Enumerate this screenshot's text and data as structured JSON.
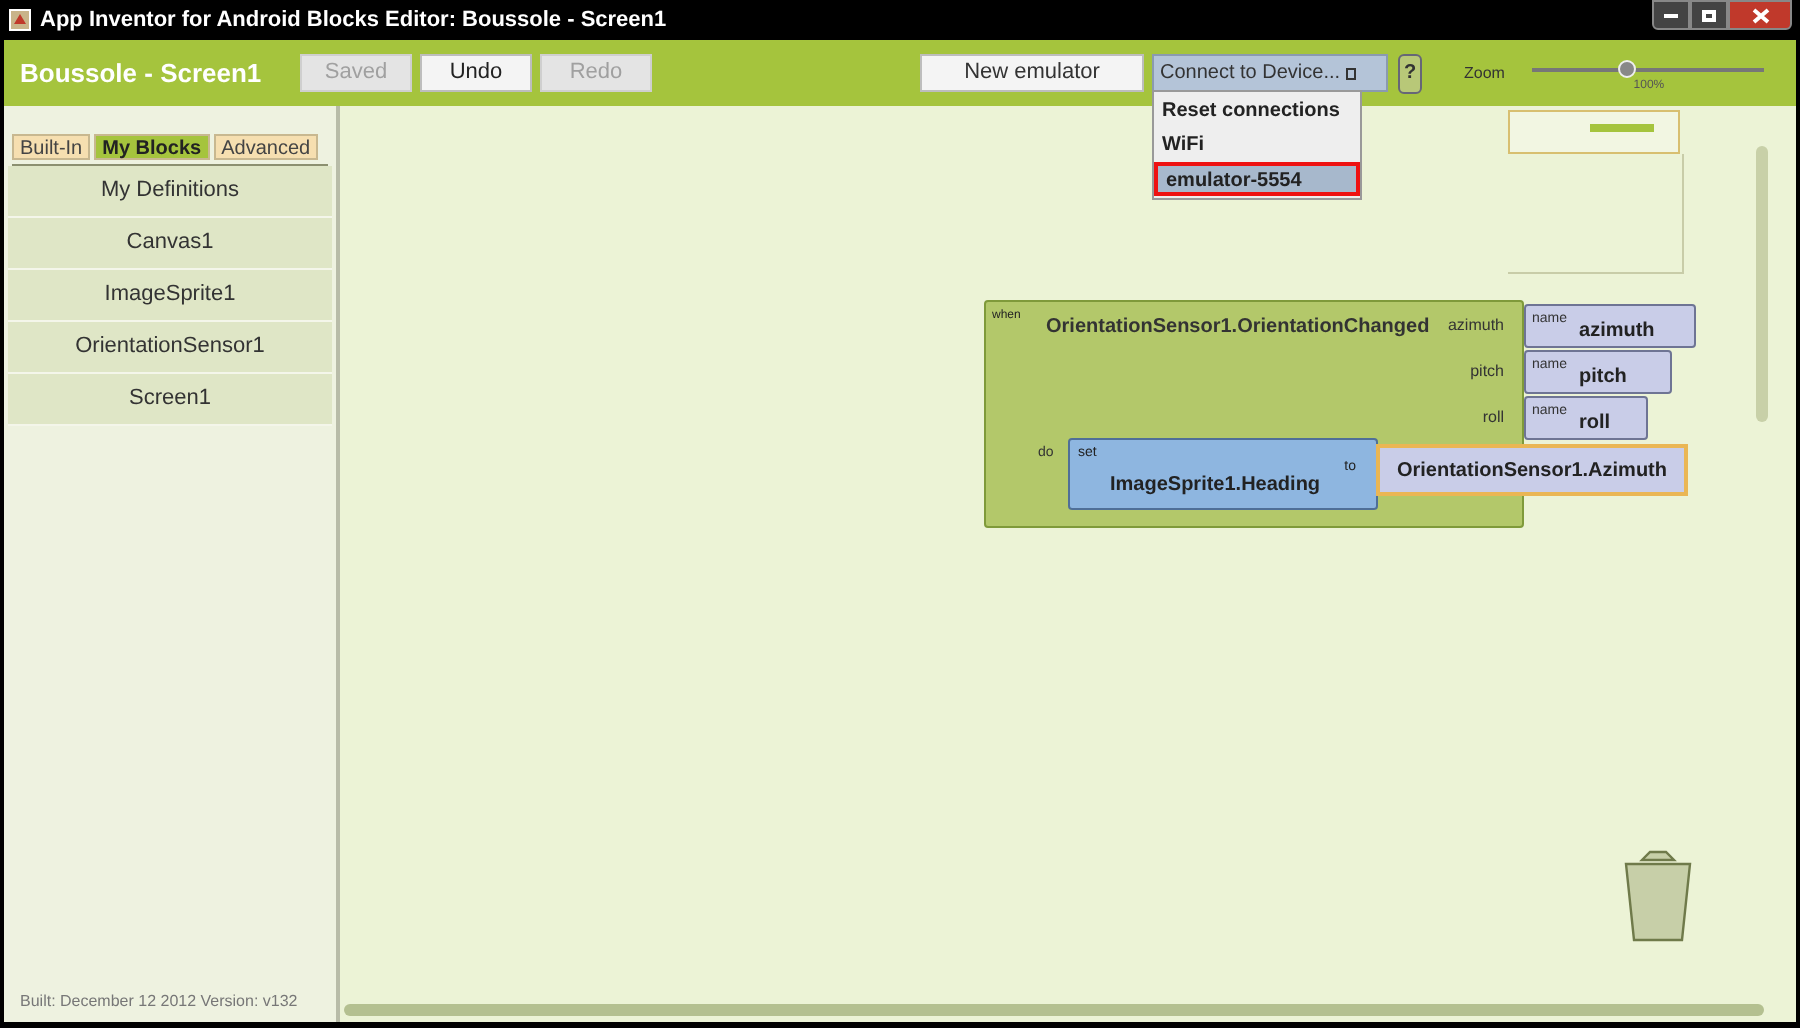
{
  "window": {
    "title": "App Inventor for Android Blocks Editor: Boussole - Screen1"
  },
  "toolbar": {
    "project_title": "Boussole - Screen1",
    "buttons": [
      {
        "label": "Saved",
        "disabled": true
      },
      {
        "label": "Undo",
        "disabled": false
      },
      {
        "label": "Redo",
        "disabled": true
      }
    ],
    "new_emulator": "New emulator",
    "connect": {
      "label": "Connect to Device..."
    },
    "help": "?",
    "zoom": {
      "label": "Zoom",
      "level": 0.4,
      "reading": "100%"
    }
  },
  "connect_menu": [
    {
      "label": "Reset connections",
      "selected": false
    },
    {
      "label": "WiFi",
      "selected": false
    },
    {
      "label": "emulator-5554",
      "selected": true
    }
  ],
  "sidebar": {
    "tabs": [
      {
        "label": "Built-In",
        "selected": false
      },
      {
        "label": "My Blocks",
        "selected": true
      },
      {
        "label": "Advanced",
        "selected": false
      }
    ],
    "items": [
      "My Definitions",
      "Canvas1",
      "ImageSprite1",
      "OrientationSensor1",
      "Screen1"
    ],
    "footer": "Built: December 12 2012 Version: v132"
  },
  "event_block": {
    "when": "when",
    "name": "OrientationSensor1.OrientationChanged",
    "params": [
      {
        "label": "azimuth",
        "name_label": "name",
        "value": "azimuth"
      },
      {
        "label": "pitch",
        "name_label": "name",
        "value": "pitch"
      },
      {
        "label": "roll",
        "name_label": "name",
        "value": "roll"
      }
    ],
    "do": "do",
    "set_block": {
      "set": "set",
      "target": "ImageSprite1.Heading",
      "to": "to",
      "value": "OrientationSensor1.Azimuth"
    }
  }
}
